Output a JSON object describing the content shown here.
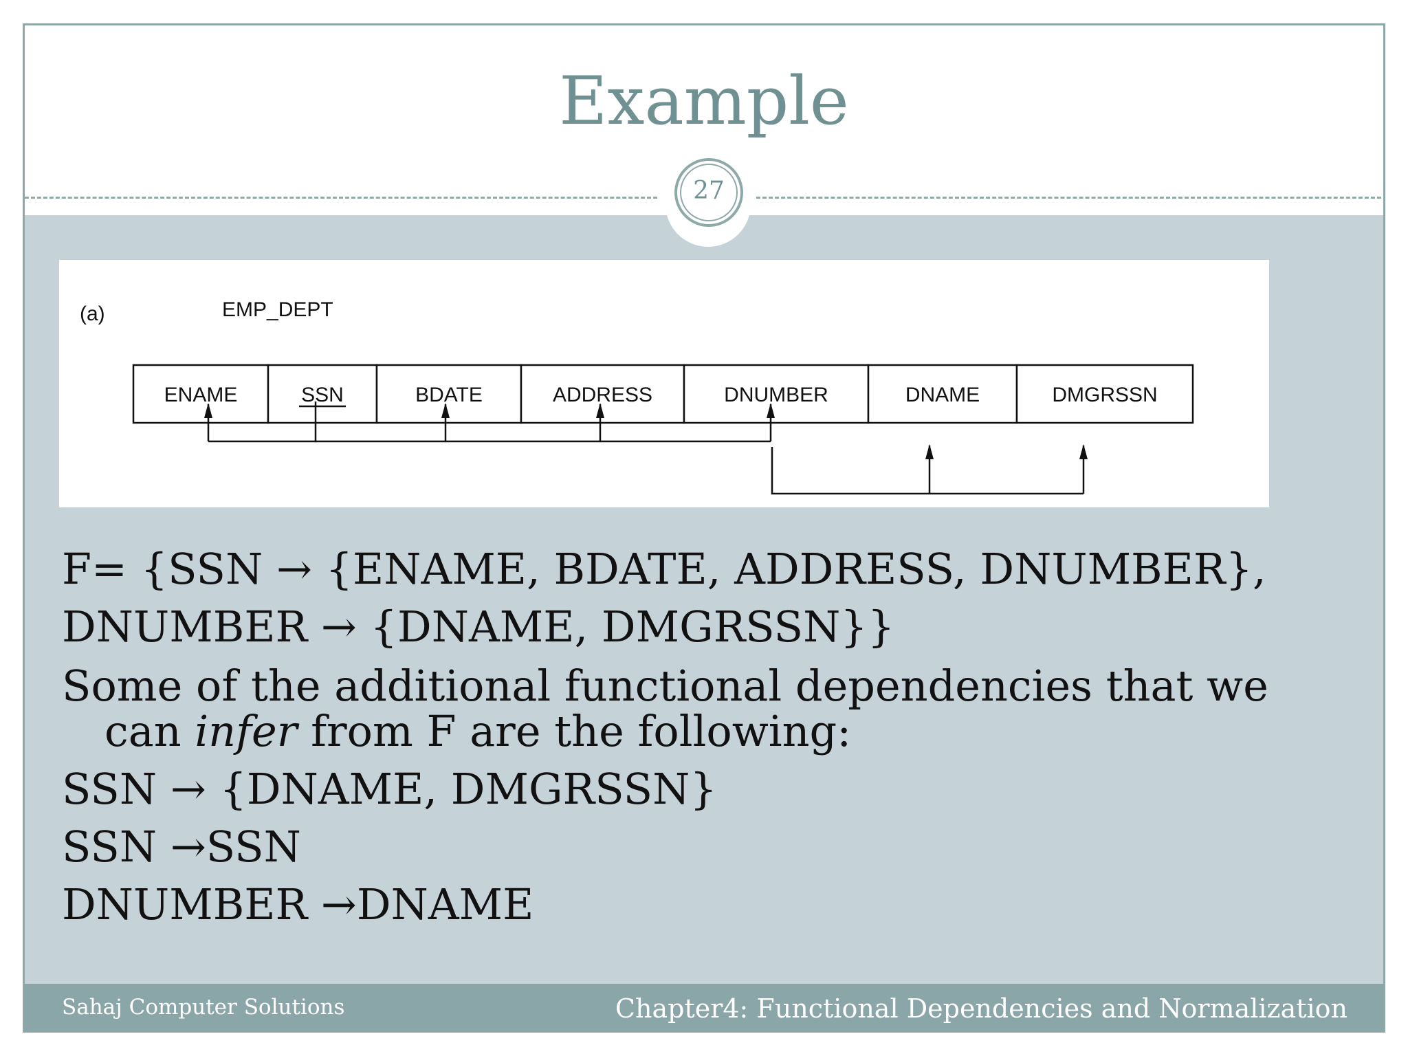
{
  "slide": {
    "title": "Example",
    "page_number": "27"
  },
  "figure": {
    "label": "(a)",
    "relation_name": "EMP_DEPT",
    "attributes": [
      "ENAME",
      "SSN",
      "BDATE",
      "ADDRESS",
      "DNUMBER",
      "DNAME",
      "DMGRSSN"
    ],
    "primary_key": "SSN",
    "dependencies": [
      {
        "from": "SSN",
        "to": [
          "ENAME",
          "BDATE",
          "ADDRESS",
          "DNUMBER"
        ]
      },
      {
        "from": "DNUMBER",
        "to": [
          "DNAME",
          "DMGRSSN"
        ]
      }
    ]
  },
  "content": {
    "line1": "F= {SSN → {ENAME, BDATE, ADDRESS, DNUMBER},",
    "line2": "DNUMBER → {DNAME, DMGRSSN}}",
    "line3": "Some of the additional functional dependencies that we",
    "line4_pre": "can ",
    "line4_em": "infer",
    "line4_post": " from F are the following:",
    "line5": "SSN → {DNAME, DMGRSSN}",
    "line6": "SSN →SSN",
    "line7": "DNUMBER →DNAME"
  },
  "footer": {
    "left": "Sahaj Computer Solutions",
    "right": "Chapter4: Functional Dependencies and Normalization"
  }
}
